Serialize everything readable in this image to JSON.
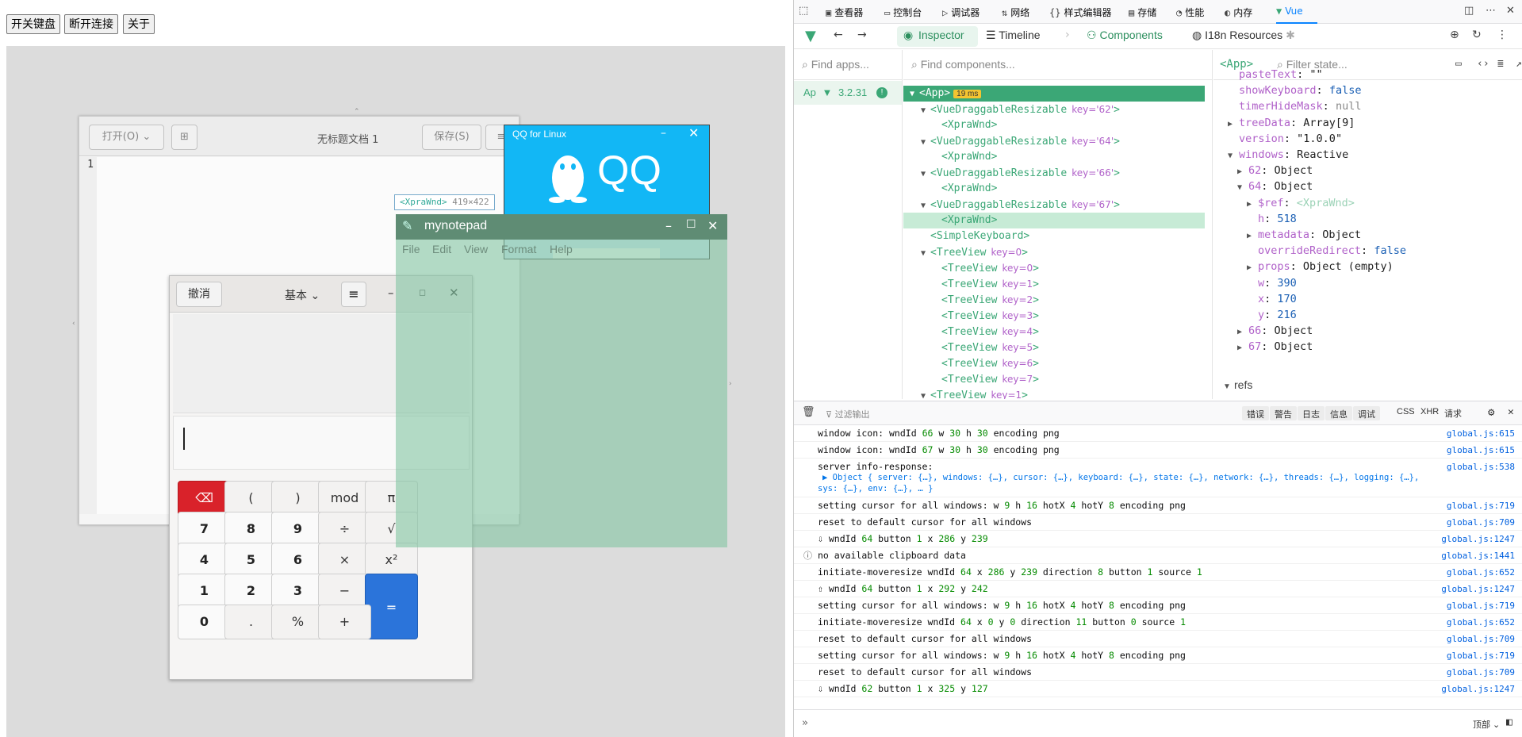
{
  "top_buttons": [
    "开关键盘",
    "断开连接",
    "关于"
  ],
  "notepad1": {
    "open_label": "打开(O)",
    "title": "无标题文档 1",
    "save_label": "保存(S)",
    "line_number": "1"
  },
  "qq": {
    "title": "QQ for Linux",
    "logo_text": "QQ"
  },
  "xpra_tag": {
    "name": "<XpraWnd>",
    "size": "419×422"
  },
  "mynotepad": {
    "title": "mynotepad",
    "menu": [
      "File",
      "Edit",
      "View",
      "Format",
      "Help"
    ]
  },
  "calculator": {
    "undo_label": "撤消",
    "mode_label": "基本",
    "keys": [
      [
        "",
        "(",
        ")",
        "mod",
        "π"
      ],
      [
        "7",
        "8",
        "9",
        "÷",
        "√"
      ],
      [
        "4",
        "5",
        "6",
        "×",
        "x²"
      ],
      [
        "1",
        "2",
        "3",
        "−",
        "="
      ],
      [
        "0",
        ".",
        "%",
        "+"
      ]
    ]
  },
  "devtools": {
    "tabs": [
      "查看器",
      "控制台",
      "调试器",
      "网络",
      "样式编辑器",
      "存储",
      "性能",
      "内存",
      "Vue"
    ],
    "vue": {
      "tabs": [
        "Inspector",
        "Timeline",
        "Components",
        "I18n Resources"
      ],
      "apps_search_placeholder": "Find apps...",
      "app_label": "Ap",
      "app_version": "3.2.31",
      "components_search_placeholder": "Find components...",
      "state_app": "<App>",
      "state_filter_placeholder": "Filter state...",
      "tree": [
        {
          "text": "<App>",
          "badge": "19 ms",
          "indent": 0,
          "arrow": "▼"
        },
        {
          "text": "<VueDraggableResizable",
          "key": "key='62'",
          "end": ">",
          "indent": 1,
          "arrow": "▼"
        },
        {
          "text": "<XpraWnd>",
          "indent": 2
        },
        {
          "text": "<VueDraggableResizable",
          "key": "key='64'",
          "end": ">",
          "indent": 1,
          "arrow": "▼"
        },
        {
          "text": "<XpraWnd>",
          "indent": 2
        },
        {
          "text": "<VueDraggableResizable",
          "key": "key='66'",
          "end": ">",
          "indent": 1,
          "arrow": "▼"
        },
        {
          "text": "<XpraWnd>",
          "indent": 2
        },
        {
          "text": "<VueDraggableResizable",
          "key": "key='67'",
          "end": ">",
          "indent": 1,
          "arrow": "▼"
        },
        {
          "text": "<XpraWnd>",
          "indent": 2
        },
        {
          "text": "<SimpleKeyboard>",
          "indent": 1
        },
        {
          "text": "<TreeView",
          "key": "key=0",
          "end": ">",
          "indent": 1,
          "arrow": "▼"
        },
        {
          "text": "<TreeView",
          "key": "key=0",
          "end": ">",
          "indent": 2
        },
        {
          "text": "<TreeView",
          "key": "key=1",
          "end": ">",
          "indent": 2
        },
        {
          "text": "<TreeView",
          "key": "key=2",
          "end": ">",
          "indent": 2
        },
        {
          "text": "<TreeView",
          "key": "key=3",
          "end": ">",
          "indent": 2
        },
        {
          "text": "<TreeView",
          "key": "key=4",
          "end": ">",
          "indent": 2
        },
        {
          "text": "<TreeView",
          "key": "key=5",
          "end": ">",
          "indent": 2
        },
        {
          "text": "<TreeView",
          "key": "key=6",
          "end": ">",
          "indent": 2
        },
        {
          "text": "<TreeView",
          "key": "key=7",
          "end": ">",
          "indent": 2
        },
        {
          "text": "<TreeView",
          "key": "key=1",
          "end": ">",
          "indent": 1,
          "arrow": "▼"
        }
      ],
      "state": [
        {
          "indent": 0,
          "key": "pasteText",
          "val": "\"\"",
          "type": "s"
        },
        {
          "indent": 0,
          "key": "showKeyboard",
          "val": "false",
          "type": "bool"
        },
        {
          "indent": 0,
          "key": "timerHideMask",
          "val": "null",
          "type": "nul"
        },
        {
          "indent": 0,
          "key": "treeData",
          "val": "Array[9]",
          "type": "s",
          "arrow": "▶"
        },
        {
          "indent": 0,
          "key": "version",
          "val": "\"1.0.0\"",
          "type": "s"
        },
        {
          "indent": 0,
          "key": "windows",
          "val": "Reactive",
          "type": "s",
          "arrow": "▼"
        },
        {
          "indent": 1,
          "key": "62",
          "val": "Object",
          "type": "s",
          "arrow": "▶"
        },
        {
          "indent": 1,
          "key": "64",
          "val": "Object",
          "type": "s",
          "arrow": "▼"
        },
        {
          "indent": 2,
          "key": "$ref",
          "val": "<XpraWnd>",
          "type": "tag",
          "arrow": "▶"
        },
        {
          "indent": 2,
          "key": "h",
          "val": "518",
          "type": "num"
        },
        {
          "indent": 2,
          "key": "metadata",
          "val": "Object",
          "type": "s",
          "arrow": "▶"
        },
        {
          "indent": 2,
          "key": "overrideRedirect",
          "val": "false",
          "type": "bool"
        },
        {
          "indent": 2,
          "key": "props",
          "val": "Object (empty)",
          "type": "s",
          "arrow": "▶"
        },
        {
          "indent": 2,
          "key": "w",
          "val": "390",
          "type": "num"
        },
        {
          "indent": 2,
          "key": "x",
          "val": "170",
          "type": "num"
        },
        {
          "indent": 2,
          "key": "y",
          "val": "216",
          "type": "num"
        },
        {
          "indent": 1,
          "key": "66",
          "val": "Object",
          "type": "s",
          "arrow": "▶"
        },
        {
          "indent": 1,
          "key": "67",
          "val": "Object",
          "type": "s",
          "arrow": "▶"
        }
      ],
      "refs_label": "refs"
    },
    "console": {
      "filter_placeholder": "过滤输出",
      "levels": [
        "错误",
        "警告",
        "日志",
        "信息",
        "调试"
      ],
      "types": [
        "CSS",
        "XHR",
        "请求"
      ],
      "bottom_right": "顶部",
      "rows": [
        {
          "msg": "window icon: wndId 66 w 30 h 30 encoding png",
          "src": "global.js:615"
        },
        {
          "msg": "window icon: wndId 67 w 30 h 30 encoding png",
          "src": "global.js:615"
        },
        {
          "msg": "server info-response:",
          "sub": "▶ Object { server: {…}, windows: {…}, cursor: {…}, keyboard: {…}, state: {…}, network: {…}, threads: {…}, logging: {…},",
          "sub2": "sys: {…}, env: {…}, … }",
          "src": "global.js:538"
        },
        {
          "msg": "setting cursor for all windows: w 9 h 16 hotX 4 hotY 8 encoding png",
          "src": "global.js:719"
        },
        {
          "msg": "reset to default cursor for all windows",
          "src": "global.js:709"
        },
        {
          "msg": "⇩ wndId 64 button 1 x 286 y 239",
          "src": "global.js:1247"
        },
        {
          "msg": "no available clipboard data",
          "src": "global.js:1441",
          "icon": "ⓘ"
        },
        {
          "msg": "initiate-moveresize wndId 64 x 286 y 239 direction 8 button 1 source 1",
          "src": "global.js:652"
        },
        {
          "msg": "⇧ wndId 64 button 1 x 292 y 242",
          "src": "global.js:1247"
        },
        {
          "msg": "setting cursor for all windows: w 9 h 16 hotX 4 hotY 8 encoding png",
          "src": "global.js:719"
        },
        {
          "msg": "initiate-moveresize wndId 64 x 0 y 0 direction 11 button 0 source 1",
          "src": "global.js:652"
        },
        {
          "msg": "reset to default cursor for all windows",
          "src": "global.js:709"
        },
        {
          "msg": "setting cursor for all windows: w 9 h 16 hotX 4 hotY 8 encoding png",
          "src": "global.js:719"
        },
        {
          "msg": "reset to default cursor for all windows",
          "src": "global.js:709"
        },
        {
          "msg": "⇩ wndId 62 button 1 x 325 y 127",
          "src": "global.js:1247"
        }
      ]
    }
  }
}
